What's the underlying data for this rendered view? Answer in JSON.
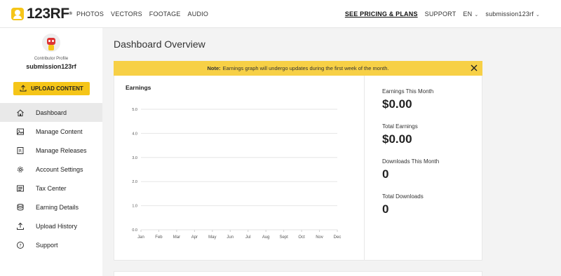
{
  "topbar": {
    "logo_text": "123RF",
    "logo_mark": "®",
    "nav_left": [
      "PHOTOS",
      "VECTORS",
      "FOOTAGE",
      "AUDIO"
    ],
    "pricing": "SEE PRICING & PLANS",
    "support": "SUPPORT",
    "language": "EN",
    "account": "submission123rf"
  },
  "sidebar": {
    "profile_label": "Contributor Profile",
    "profile_name": "submission123rf",
    "upload_label": "UPLOAD CONTENT",
    "items": [
      {
        "label": "Dashboard",
        "icon": "home-icon",
        "active": true
      },
      {
        "label": "Manage Content",
        "icon": "image-icon"
      },
      {
        "label": "Manage Releases",
        "icon": "release-icon"
      },
      {
        "label": "Account Settings",
        "icon": "gear-icon"
      },
      {
        "label": "Tax Center",
        "icon": "tax-icon"
      },
      {
        "label": "Earning Details",
        "icon": "coins-icon"
      },
      {
        "label": "Upload History",
        "icon": "upload-icon"
      },
      {
        "label": "Support",
        "icon": "help-icon"
      }
    ]
  },
  "main": {
    "title": "Dashboard Overview",
    "note_bold": "Note:",
    "note_text": "Earnings graph will undergo updates during the first week of the month.",
    "earnings_title": "Earnings",
    "stats": [
      {
        "label": "Earnings This Month",
        "value": "$0.00"
      },
      {
        "label": "Total Earnings",
        "value": "$0.00"
      },
      {
        "label": "Downloads This Month",
        "value": "0"
      },
      {
        "label": "Total Downloads",
        "value": "0"
      }
    ]
  },
  "chart_data": {
    "type": "line",
    "categories": [
      "Jan",
      "Feb",
      "Mar",
      "Apr",
      "May",
      "Jun",
      "Jul",
      "Aug",
      "Sept",
      "Oct",
      "Nov",
      "Dec"
    ],
    "series": [
      {
        "values": [
          0,
          0,
          0,
          0,
          0,
          0,
          0,
          0,
          0,
          0,
          0,
          0
        ]
      }
    ],
    "yticks": [
      "0.0",
      "1.0",
      "2.0",
      "3.0",
      "4.0",
      "5.0"
    ],
    "ylim": [
      0,
      5
    ],
    "grid": true
  },
  "colors": {
    "accent": "#f5c518",
    "note_bg": "#f7d046",
    "active_item": "#e9e9e9"
  }
}
